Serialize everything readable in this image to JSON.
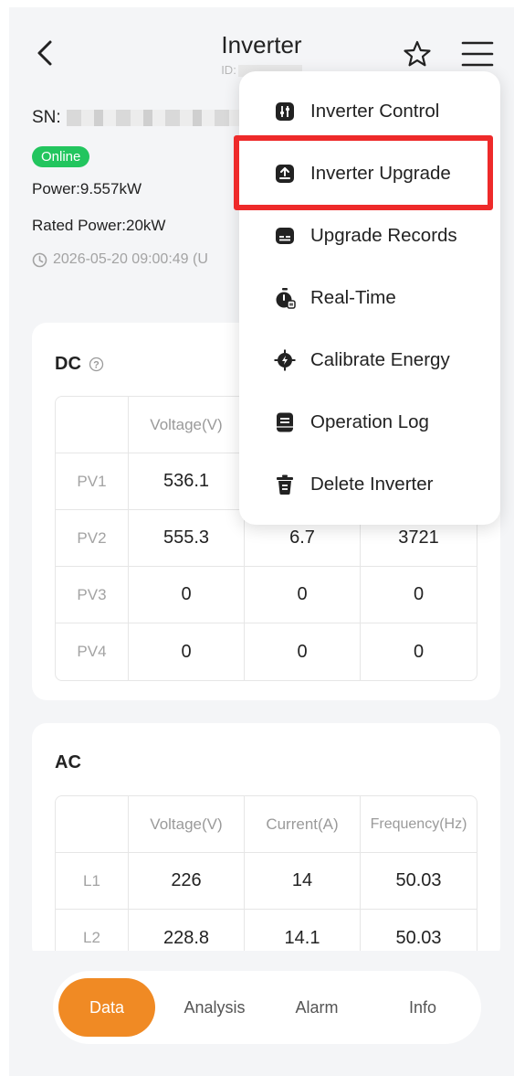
{
  "header": {
    "title": "Inverter",
    "id_label": "ID:"
  },
  "device": {
    "sn_label": "SN:",
    "status": "Online",
    "power": "Power:9.557kW",
    "rated_power": "Rated Power:20kW",
    "timestamp": "2026-05-20 09:00:49 (U"
  },
  "dc": {
    "title": "DC",
    "columns": [
      "",
      "Voltage(V)",
      "",
      ""
    ],
    "rows": [
      {
        "label": "PV1",
        "voltage": "536.1",
        "current": "",
        "power": ""
      },
      {
        "label": "PV2",
        "voltage": "555.3",
        "current": "6.7",
        "power": "3721"
      },
      {
        "label": "PV3",
        "voltage": "0",
        "current": "0",
        "power": "0"
      },
      {
        "label": "PV4",
        "voltage": "0",
        "current": "0",
        "power": "0"
      }
    ]
  },
  "ac": {
    "title": "AC",
    "columns": [
      "",
      "Voltage(V)",
      "Current(A)",
      "Frequency(Hz)"
    ],
    "rows": [
      {
        "label": "L1",
        "voltage": "226",
        "current": "14",
        "frequency": "50.03"
      },
      {
        "label": "L2",
        "voltage": "228.8",
        "current": "14.1",
        "frequency": "50.03"
      }
    ]
  },
  "menu": {
    "items": [
      {
        "label": "Inverter Control",
        "icon": "sliders-icon"
      },
      {
        "label": "Inverter Upgrade",
        "icon": "upload-icon"
      },
      {
        "label": "Upgrade Records",
        "icon": "records-icon"
      },
      {
        "label": "Real-Time",
        "icon": "stopwatch-icon"
      },
      {
        "label": "Calibrate Energy",
        "icon": "energy-target-icon"
      },
      {
        "label": "Operation Log",
        "icon": "log-icon"
      },
      {
        "label": "Delete Inverter",
        "icon": "trash-icon"
      }
    ],
    "highlighted": "Inverter Upgrade"
  },
  "tabs": [
    {
      "label": "Data",
      "active": true
    },
    {
      "label": "Analysis",
      "active": false
    },
    {
      "label": "Alarm",
      "active": false
    },
    {
      "label": "Info",
      "active": false
    }
  ],
  "colors": {
    "accent": "#f08a24",
    "online": "#22c55e",
    "highlight_border": "#ee2a2a"
  }
}
